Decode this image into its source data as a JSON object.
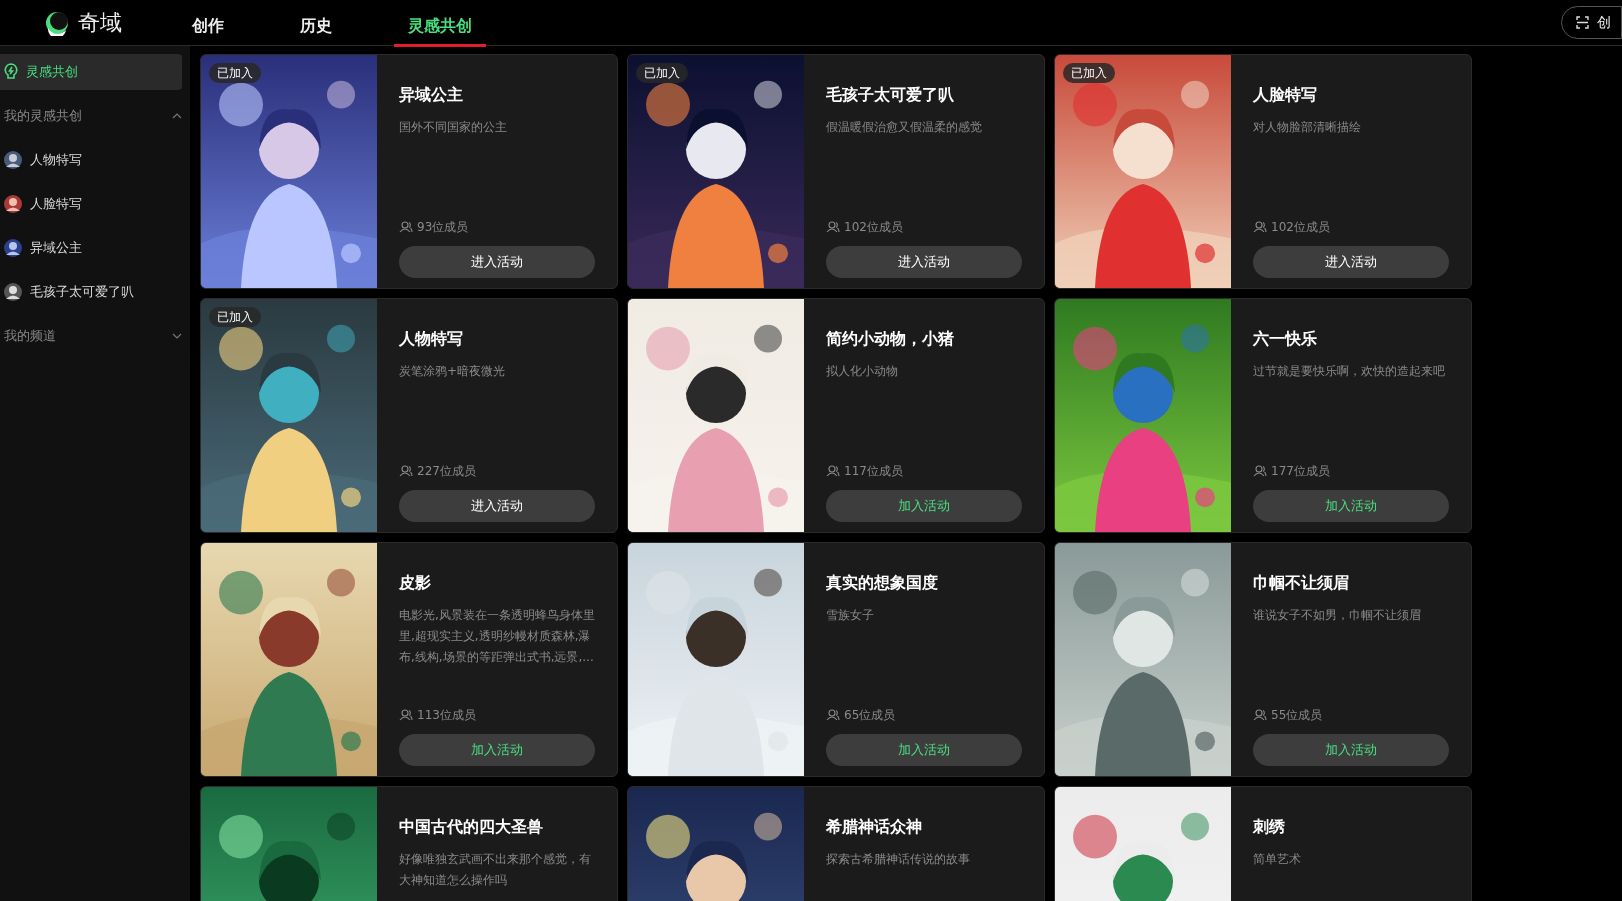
{
  "header": {
    "logo_text": "奇域",
    "tabs": [
      {
        "label": "创作",
        "selected": false
      },
      {
        "label": "历史",
        "selected": false
      },
      {
        "label": "灵感共创",
        "selected": true
      }
    ],
    "action_button": "创"
  },
  "sidebar": {
    "items": [
      {
        "kind": "link",
        "label": "灵感共创",
        "selected": true
      },
      {
        "kind": "section",
        "label": "我的灵感共创",
        "expanded": true
      },
      {
        "kind": "channel",
        "label": "人物特写",
        "selected": false
      },
      {
        "kind": "channel",
        "label": "人脸特写",
        "selected": false
      },
      {
        "kind": "channel",
        "label": "异域公主",
        "selected": false
      },
      {
        "kind": "channel",
        "label": "毛孩子太可爱了叭",
        "selected": false
      },
      {
        "kind": "section",
        "label": "我的频道",
        "expanded": false
      }
    ]
  },
  "cards": [
    {
      "title": "异域公主",
      "description": "国外不同国家的公主",
      "badge": "已加入",
      "members": "93位成员",
      "button": {
        "label": "进入活动",
        "kind": "enter"
      }
    },
    {
      "title": "毛孩子太可爱了叭",
      "description": "假温暖假治愈又假温柔的感觉",
      "badge": "已加入",
      "members": "102位成员",
      "button": {
        "label": "进入活动",
        "kind": "enter"
      }
    },
    {
      "title": "人脸特写",
      "description": "对人物脸部清晰描绘",
      "badge": "已加入",
      "members": "102位成员",
      "button": {
        "label": "进入活动",
        "kind": "enter"
      }
    },
    {
      "title": "人物特写",
      "description": "炭笔涂鸦+暗夜微光",
      "badge": "已加入",
      "members": "227位成员",
      "button": {
        "label": "进入活动",
        "kind": "enter"
      }
    },
    {
      "title": "简约小动物，小猪",
      "description": "拟人化小动物",
      "members": "117位成员",
      "button": {
        "label": "加入活动",
        "kind": "join"
      }
    },
    {
      "title": "六一快乐",
      "description": "过节就是要快乐啊，欢快的造起来吧",
      "members": "177位成员",
      "button": {
        "label": "加入活动",
        "kind": "join"
      }
    },
    {
      "title": "皮影",
      "description": "电影光,风景装在一条透明蜂鸟身体里里,超现实主义,透明纱幔材质森林,瀑布,线构,场景的等距弹出式书,远景,...",
      "members": "113位成员",
      "button": {
        "label": "加入活动",
        "kind": "join"
      }
    },
    {
      "title": "真实的想象国度",
      "description": "雪族女子",
      "members": "65位成员",
      "button": {
        "label": "加入活动",
        "kind": "join"
      }
    },
    {
      "title": "巾帼不让须眉",
      "description": "谁说女子不如男，巾帼不让须眉",
      "members": "55位成员",
      "button": {
        "label": "加入活动",
        "kind": "join"
      }
    },
    {
      "title": "中国古代的四大圣兽",
      "description": "好像唯独玄武画不出来那个感觉，有大神知道怎么操作吗"
    },
    {
      "title": "希腊神话众神",
      "description": "探索古希腊神话传说的故事"
    },
    {
      "title": "刺绣",
      "description": "简单艺术"
    }
  ]
}
